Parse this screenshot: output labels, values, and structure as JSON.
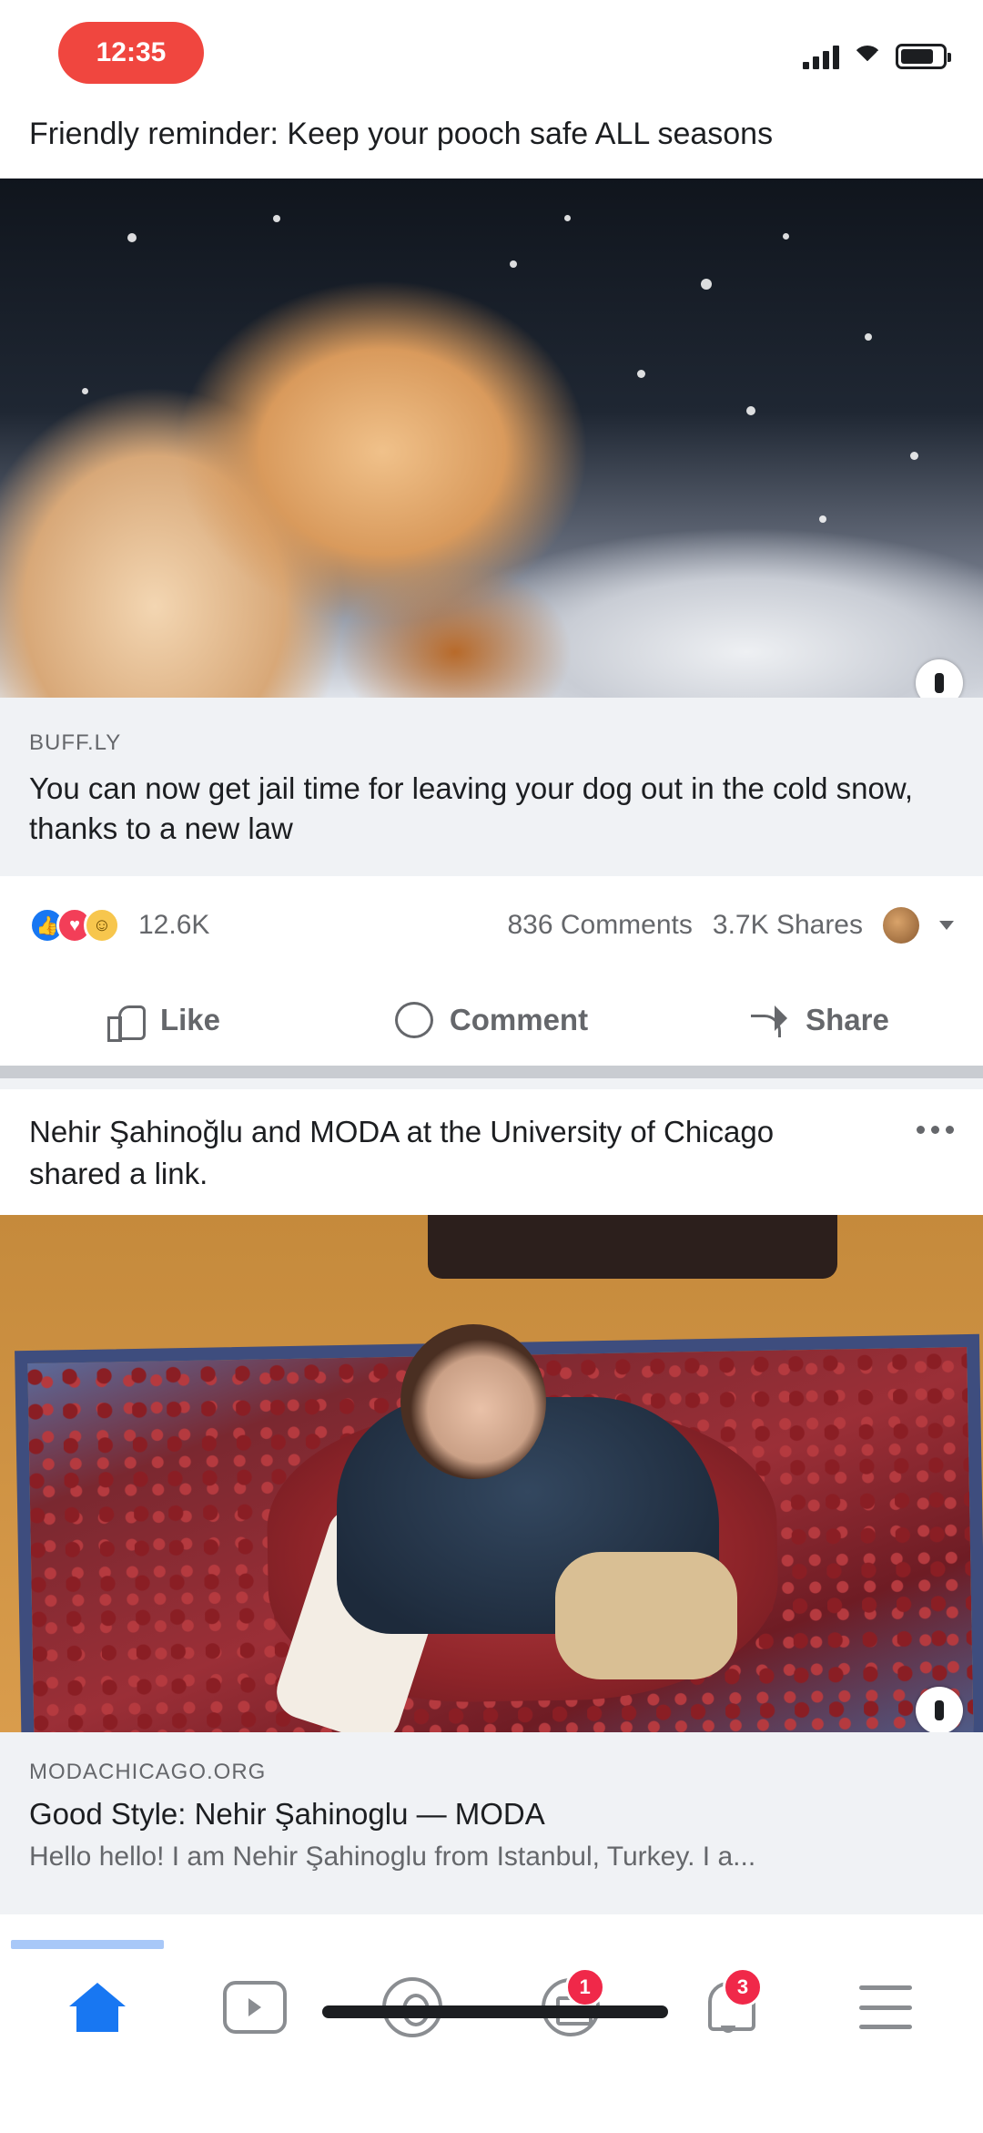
{
  "status_bar": {
    "time": "12:35"
  },
  "post1": {
    "caption": "Friendly reminder: Keep your pooch safe ALL seasons",
    "link": {
      "domain": "BUFF.LY",
      "title": "You can now get jail time for leaving your dog out in the cold snow, thanks to a new law"
    },
    "reactions": {
      "count": "12.6K",
      "comments": "836 Comments",
      "shares": "3.7K Shares"
    },
    "actions": {
      "like": "Like",
      "comment": "Comment",
      "share": "Share"
    }
  },
  "post2": {
    "header": "Nehir Şahinoğlu and MODA at the University of Chicago shared a link.",
    "link": {
      "domain": "MODACHICAGO.ORG",
      "title": "Good Style: Nehir Şahinoglu — MODA",
      "description": "Hello hello! I am Nehir Şahinoglu from Istanbul, Turkey. I a..."
    }
  },
  "bottom_nav": {
    "items": [
      {
        "name": "Home",
        "icon": "home-icon",
        "active": true
      },
      {
        "name": "Watch",
        "icon": "watch-icon"
      },
      {
        "name": "Groups",
        "icon": "groups-icon"
      },
      {
        "name": "Marketplace",
        "icon": "marketplace-icon",
        "badge": "1"
      },
      {
        "name": "Notifications",
        "icon": "bell-icon",
        "badge": "3"
      },
      {
        "name": "Menu",
        "icon": "menu-icon"
      }
    ]
  },
  "colors": {
    "accent": "#1877f2",
    "badge": "#f02849",
    "time_pill": "#f0463f"
  }
}
